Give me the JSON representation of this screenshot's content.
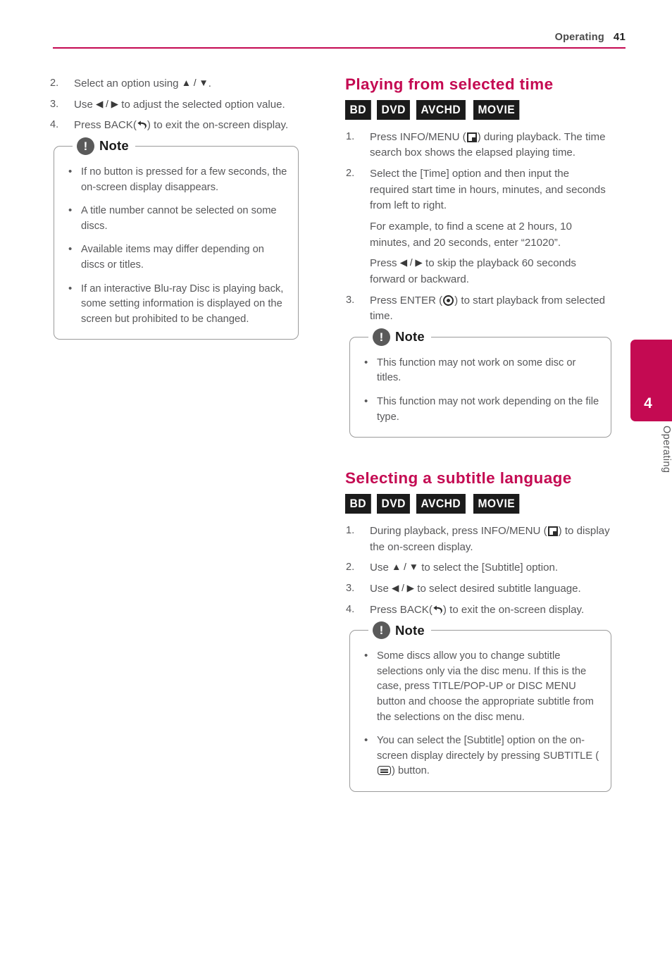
{
  "header": {
    "chapter_label": "Operating",
    "page_number": "41",
    "rule_color": "#c40a52"
  },
  "chapter_tab": {
    "number": "4",
    "name": "Operating",
    "color": "#c40a52"
  },
  "left_column": {
    "steps": [
      {
        "num": "2.",
        "text_before": "Select an option using ",
        "arrows": "▲ / ▼",
        "text_after": "."
      },
      {
        "num": "3.",
        "text_before": "Use ",
        "arrows": "◀ / ▶",
        "text_after": " to adjust the selected option value."
      },
      {
        "num": "4.",
        "text_before": "Press BACK(",
        "icon": "back-icon",
        "text_after": ") to exit the on-screen display."
      }
    ],
    "note": {
      "title": "Note",
      "icon": "exclamation-icon",
      "items": [
        "If no button is pressed for a few seconds, the on-screen display disappears.",
        "A title number cannot be selected on some discs.",
        "Available items may differ depending on discs or titles.",
        "If an interactive Blu-ray Disc is playing back, some setting information is displayed on the screen but prohibited to be changed."
      ]
    }
  },
  "right_column": {
    "section_1": {
      "heading": "Playing from selected time",
      "badges": [
        "BD",
        "DVD",
        "AVCHD",
        "MOVIE"
      ],
      "steps": [
        {
          "num": "1.",
          "text_before": "Press INFO/MENU (",
          "icon": "info-menu-icon",
          "text_after": ") during playback. The time search box shows the elapsed playing time."
        },
        {
          "num": "2.",
          "text_before": "Select the [Time] option and then input the required start time in hours, minutes, and seconds from left to right.",
          "text_after": ""
        },
        {
          "num": "3.",
          "text_before": "Press ENTER (",
          "icon": "enter-icon",
          "text_after": ") to start playback from selected time."
        }
      ],
      "substeps": [
        {
          "text": "For example, to find a scene at 2 hours, 10 minutes, and 20 seconds, enter “21020”."
        },
        {
          "text_before": "Press ",
          "arrows": "◀ / ▶",
          "text_after": " to skip the playback 60 seconds forward or backward."
        }
      ],
      "note": {
        "title": "Note",
        "icon": "exclamation-icon",
        "items": [
          "This function may not work on some disc or titles.",
          "This function may not work depending on the file type."
        ]
      }
    },
    "section_2": {
      "heading": "Selecting a subtitle language",
      "badges": [
        "BD",
        "DVD",
        "AVCHD",
        "MOVIE"
      ],
      "steps": [
        {
          "num": "1.",
          "text_before": "During playback, press INFO/MENU (",
          "icon": "info-menu-icon",
          "text_after": ") to display the on-screen display."
        },
        {
          "num": "2.",
          "text_before": "Use ",
          "arrows": "▲ / ▼",
          "text_after": " to select the [Subtitle] option."
        },
        {
          "num": "3.",
          "text_before": "Use ",
          "arrows": "◀ / ▶",
          "text_after": " to select desired subtitle language."
        },
        {
          "num": "4.",
          "text_before": "Press BACK(",
          "icon": "back-icon",
          "text_after": ") to exit the on-screen display."
        }
      ],
      "note": {
        "title": "Note",
        "icon": "exclamation-icon",
        "items": [
          "Some discs allow you to change subtitle selections only via the disc menu. If this is the case, press TITLE/POP-UP or DISC MENU button and choose the appropriate subtitle from the selections on the disc menu.",
          {
            "text_before": "You can select the [Subtitle] option on the on-screen display directely by pressing SUBTITLE (",
            "icon": "subtitle-icon",
            "text_after": ") button."
          }
        ]
      }
    }
  }
}
